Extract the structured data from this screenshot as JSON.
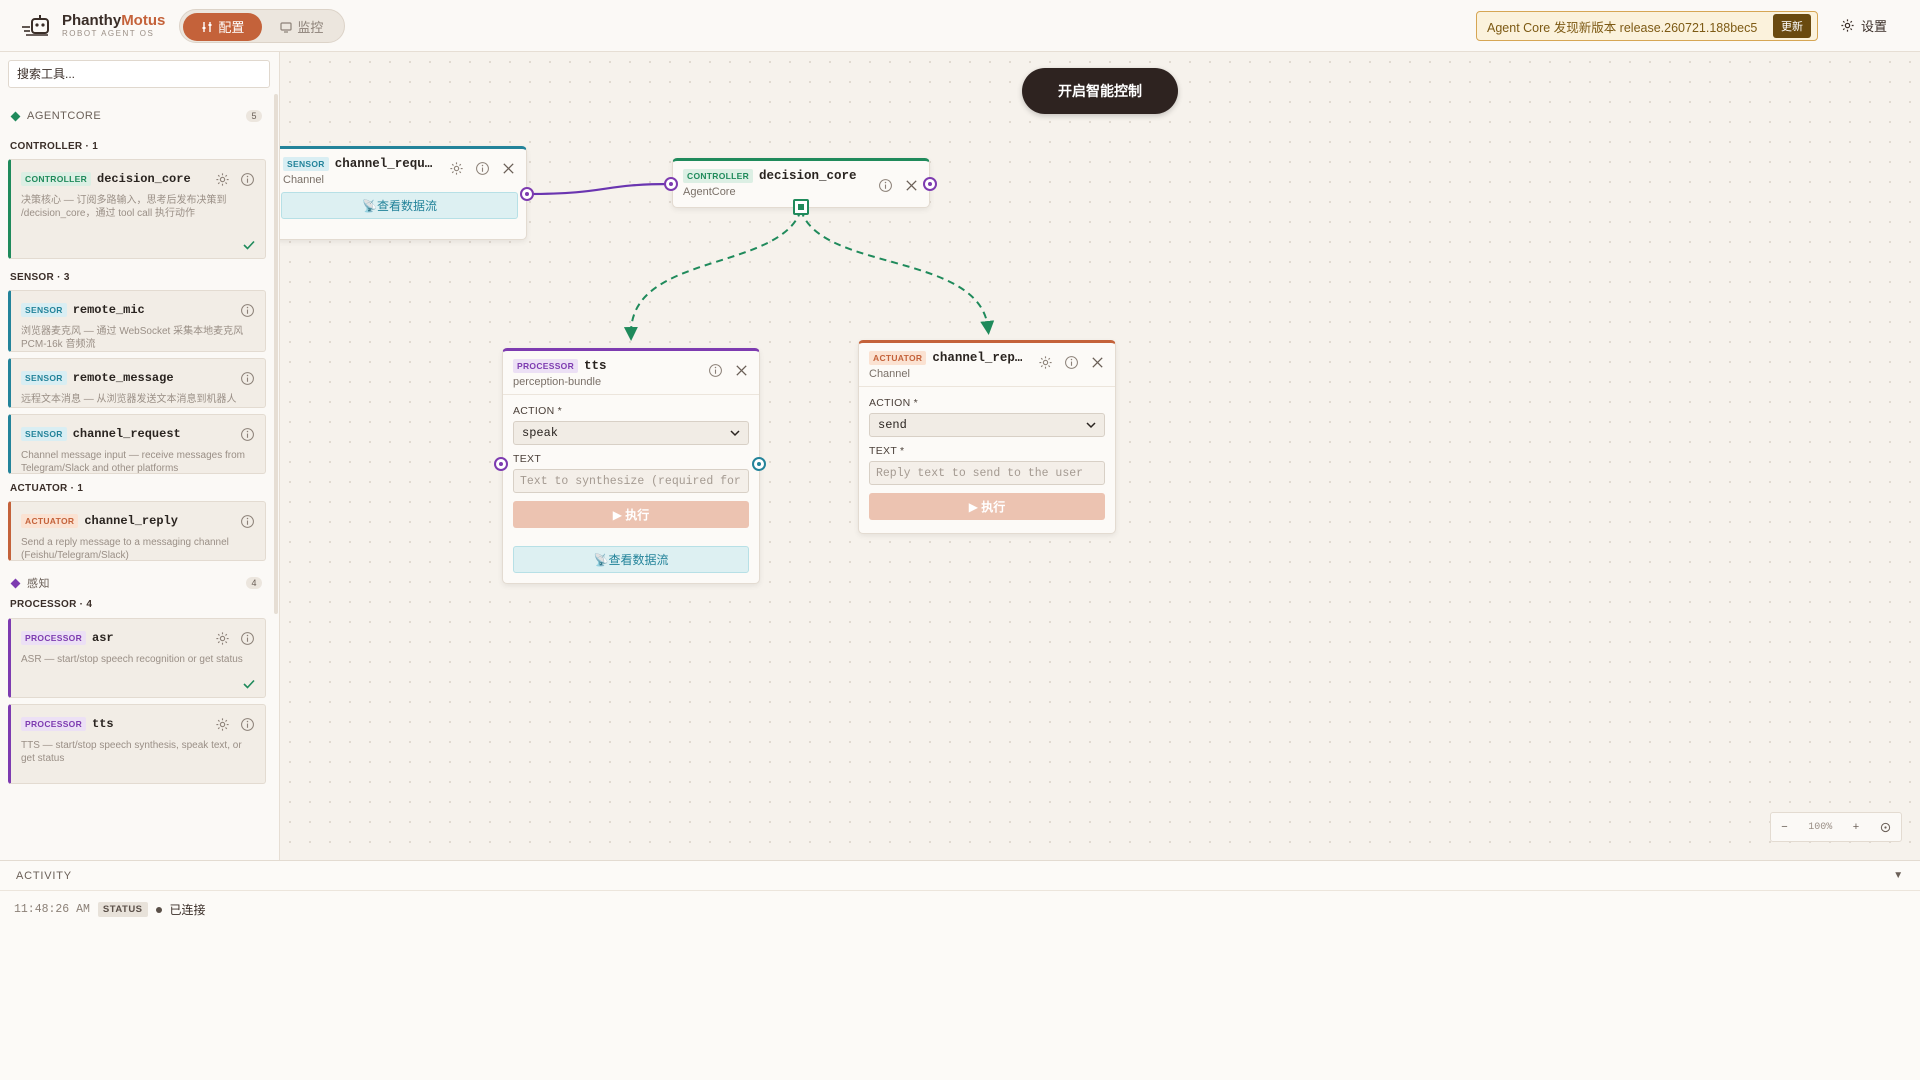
{
  "header": {
    "logo_title_a": "Phanthy",
    "logo_title_b": "Motus",
    "logo_sub": "ROBOT AGENT OS",
    "mode_config": "配置",
    "mode_monitor": "监控",
    "update_text": "Agent Core 发现新版本 release.260721.188bec5",
    "update_button": "更新",
    "settings_label": "设置"
  },
  "sidebar": {
    "search_placeholder": "搜索工具...",
    "group_agentcore": {
      "label": "AGENTCORE",
      "count": "5"
    },
    "controller_head": "CONTROLLER · 1",
    "sensor_head": "SENSOR · 3",
    "actuator_head": "ACTUATOR · 1",
    "group_perception": {
      "label": "感知",
      "count": "4"
    },
    "processor_head": "PROCESSOR · 4",
    "cards": [
      {
        "badge": "CONTROLLER",
        "name": "decision_core",
        "desc": "决策核心 — 订阅多路输入，思考后发布决策到 /decision_core，通过 tool call 执行动作"
      },
      {
        "badge": "SENSOR",
        "name": "remote_mic",
        "desc": "浏览器麦克风 — 通过 WebSocket 采集本地麦克风 PCM-16k 音频流"
      },
      {
        "badge": "SENSOR",
        "name": "remote_message",
        "desc": "远程文本消息 — 从浏览器发送文本消息到机器人"
      },
      {
        "badge": "SENSOR",
        "name": "channel_request",
        "desc": "Channel message input — receive messages from Telegram/Slack and other platforms"
      },
      {
        "badge": "ACTUATOR",
        "name": "channel_reply",
        "desc": "Send a reply message to a messaging channel (Feishu/Telegram/Slack)"
      },
      {
        "badge": "PROCESSOR",
        "name": "asr",
        "desc": "ASR — start/stop speech recognition or get status"
      },
      {
        "badge": "PROCESSOR",
        "name": "tts",
        "desc": "TTS — start/stop speech synthesis, speak text, or get status"
      }
    ]
  },
  "canvas": {
    "smart_button": "开启智能控制",
    "zoom_minus": "−",
    "zoom_value": "100%",
    "zoom_plus": "+",
    "nodes": {
      "channel_request": {
        "badge": "SENSOR",
        "name": "channel_requ…",
        "sub": "Channel",
        "flow": "查看数据流"
      },
      "decision_core": {
        "badge": "CONTROLLER",
        "name": "decision_core",
        "sub": "AgentCore"
      },
      "tts": {
        "badge": "PROCESSOR",
        "name": "tts",
        "sub": "perception-bundle",
        "action_label": "ACTION *",
        "action_value": "speak",
        "text_label": "TEXT",
        "text_placeholder": "Text to synthesize (required for speak)",
        "exec": "▶ 执行",
        "flow": "查看数据流"
      },
      "channel_reply": {
        "badge": "ACTUATOR",
        "name": "channel_rep…",
        "sub": "Channel",
        "action_label": "ACTION *",
        "action_value": "send",
        "text_label": "TEXT *",
        "text_placeholder": "Reply text to send to the user",
        "exec": "▶ 执行"
      }
    }
  },
  "activity": {
    "title": "ACTIVITY",
    "log": [
      {
        "time": "11:48:26 AM",
        "tag": "STATUS",
        "text": "已连接"
      }
    ]
  },
  "colors": {
    "accent": "#c4623a",
    "controller": "#1f8a5b",
    "sensor": "#23839a",
    "actuator": "#c4623a",
    "processor": "#7d3bb0"
  }
}
